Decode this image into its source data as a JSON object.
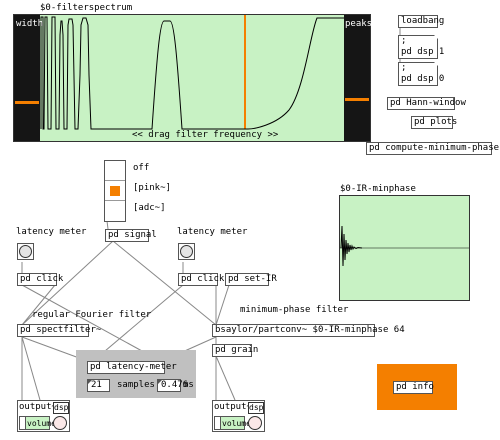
{
  "spectrum": {
    "title": "$0-filterspectrum",
    "left_label": "width",
    "right_label": "peaks",
    "drag_label": "<< drag filter frequency >>"
  },
  "loadbang": "loadbang",
  "dsp_on": ";\npd dsp 1",
  "dsp_off": ";\npd dsp 0",
  "hann": "pd Hann-window",
  "plots": "pd plots",
  "compute_ir": "pd compute-minimum-phase-IR",
  "radio": {
    "options": [
      "off",
      "[pink~]",
      "[adc~]"
    ],
    "selected_index": 1
  },
  "signal": "pd signal",
  "latency_left": {
    "label": "latency meter",
    "click": "pd click"
  },
  "latency_right": {
    "label": "latency meter",
    "click": "pd click"
  },
  "set_ir": "pd set-IR",
  "ir_graph": {
    "title": "$0-IR-minphase"
  },
  "regular_label": "regular Fourier filter",
  "minphase_label": "minimum-phase filter",
  "spectfilter": "pd spectfilter~",
  "partconv": "bsaylor/partconv~ $0-IR-minphase 64",
  "grain": "pd grain",
  "latency_meter": {
    "title": "pd latency-meter",
    "samples_value": "21",
    "samples_label": "samples",
    "ms_value": "0.476",
    "ms_label": "ms"
  },
  "pd_info": "pd info",
  "output_left": {
    "title": "output~",
    "dsp": "dsp",
    "volume": "volume"
  },
  "output_right": {
    "title": "output~",
    "dsp": "dsp",
    "volume": "volume"
  },
  "colors": {
    "graph_fill": "#c8f2c4",
    "accent_orange": "#f47f00",
    "dark_panel": "#151515",
    "gray_panel": "#c0c0c0"
  }
}
